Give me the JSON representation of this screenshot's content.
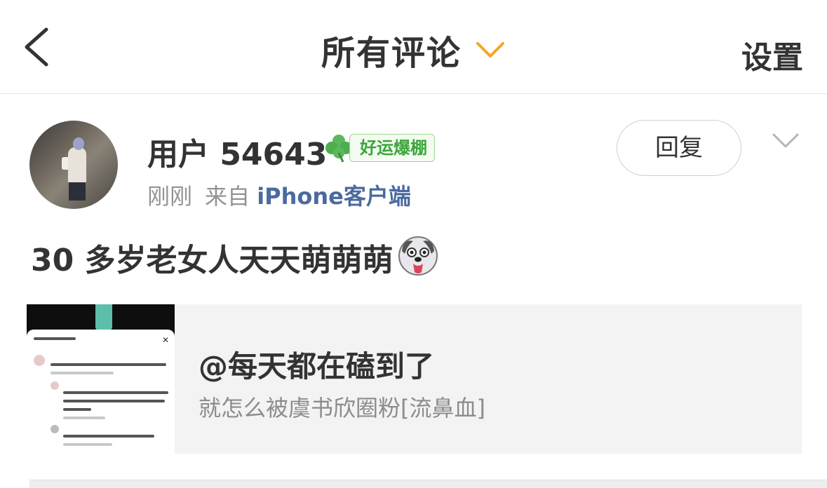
{
  "header": {
    "title": "所有评论",
    "settings_label": "设置"
  },
  "comment": {
    "username": "用户 54643",
    "badge_label": "好运爆棚",
    "time": "刚刚",
    "source_prefix": "来自",
    "source_client": "iPhone客户端",
    "reply_label": "回复",
    "text": "30 多岁老女人天天萌萌萌"
  },
  "quoted_post": {
    "title": "@每天都在磕到了",
    "subtitle": "就怎么被虞书欣圈粉[流鼻血]"
  },
  "colors": {
    "accent_orange": "#f5a623",
    "badge_green": "#3aa63a",
    "link_blue": "#4b6a9e"
  },
  "icons": [
    "back-arrow-icon",
    "chevron-down-icon",
    "clover-icon",
    "dog-emoji-icon"
  ]
}
